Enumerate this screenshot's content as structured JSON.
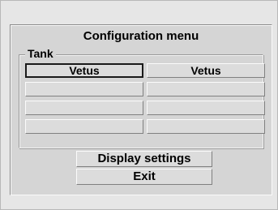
{
  "menu": {
    "title": "Configuration menu",
    "group_label": "Tank",
    "tanks": [
      {
        "left": "Vetus",
        "right": "Vetus"
      },
      {
        "left": "",
        "right": ""
      },
      {
        "left": "",
        "right": ""
      },
      {
        "left": "",
        "right": ""
      }
    ],
    "selected": "row 1, left"
  },
  "buttons": {
    "display_settings": "Display settings",
    "exit": "Exit"
  }
}
